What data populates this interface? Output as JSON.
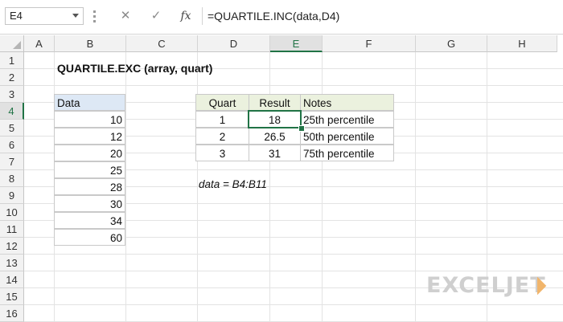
{
  "formula_bar": {
    "name_box": "E4",
    "cancel_icon": "✕",
    "enter_icon": "✓",
    "fx_label": "fx",
    "formula": "=QUARTILE.INC(data,D4)"
  },
  "columns": [
    "A",
    "B",
    "C",
    "D",
    "E",
    "F",
    "G",
    "H"
  ],
  "rows": [
    "1",
    "2",
    "3",
    "4",
    "5",
    "6",
    "7",
    "8",
    "9",
    "10",
    "11",
    "12",
    "13",
    "14",
    "15",
    "16"
  ],
  "active_cell": "E4",
  "sheet": {
    "title": "QUARTILE.EXC (array, quart)",
    "data_header": "Data",
    "data_values": [
      "10",
      "12",
      "20",
      "25",
      "28",
      "30",
      "34",
      "60"
    ],
    "quart_table": {
      "headers": [
        "Quart",
        "Result",
        "Notes"
      ],
      "rows": [
        {
          "quart": "1",
          "result": "18",
          "note": "25th percentile"
        },
        {
          "quart": "2",
          "result": "26.5",
          "note": "50th percentile"
        },
        {
          "quart": "3",
          "result": "31",
          "note": "75th percentile"
        }
      ]
    },
    "named_range_note": "data = B4:B11"
  },
  "watermark": {
    "text": "EXCELJET",
    "accent_color": "#f1b56b"
  },
  "colors": {
    "accent": "#217346",
    "data_header_fill": "#dde8f5",
    "table_header_fill": "#ebf1de"
  }
}
